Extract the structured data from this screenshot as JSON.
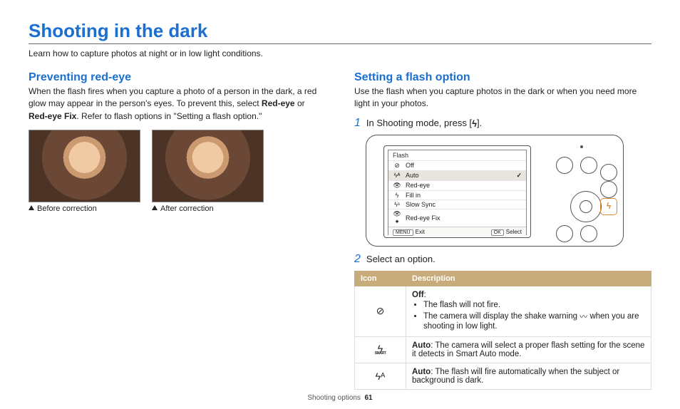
{
  "page_title": "Shooting in the dark",
  "intro": "Learn how to capture photos at night or in low light conditions.",
  "left": {
    "section_title": "Preventing red-eye",
    "text_1": "When the flash fires when you capture a photo of a person in the dark, a red glow may appear in the person's eyes. To prevent this, select ",
    "bold_1": "Red-eye",
    "text_2": " or ",
    "bold_2": "Red-eye Fix",
    "text_3": ". Refer to flash options in \"Setting a flash option.\"",
    "caption_before": "Before correction",
    "caption_after": "After correction"
  },
  "right": {
    "section_title": "Setting a flash option",
    "intro": "Use the flash when you capture photos in the dark or when you need more light in your photos.",
    "step1_pre": "In Shooting mode, press [",
    "step1_post": "].",
    "step2": "Select an option.",
    "menu": {
      "header": "Flash",
      "items": [
        {
          "icon": "⊘",
          "label": "Off"
        },
        {
          "icon": "ϟᴬ",
          "label": "Auto",
          "selected": true
        },
        {
          "icon": "👁",
          "label": "Red-eye"
        },
        {
          "icon": "ϟ",
          "label": "Fill in"
        },
        {
          "icon": "ϟˢ",
          "label": "Slow Sync"
        },
        {
          "icon": "👁✦",
          "label": "Red-eye Fix"
        }
      ],
      "footer_left_btn": "MENU",
      "footer_left": "Exit",
      "footer_right_btn": "OK",
      "footer_right": "Select"
    },
    "table": {
      "col_icon": "Icon",
      "col_desc": "Description",
      "rows": [
        {
          "icon": "⊘",
          "title": "Off",
          "bullets": [
            "The flash will not fire.",
            "The camera will display the shake warning 〰 when you are shooting in low light."
          ]
        },
        {
          "icon": "ϟSMART",
          "title": "Auto",
          "text": ": The camera will select a proper flash setting for the scene it detects in Smart Auto mode."
        },
        {
          "icon": "ϟᴬ",
          "title": "Auto",
          "text": ": The flash will fire automatically when the subject or background is dark."
        }
      ]
    }
  },
  "footer": {
    "section": "Shooting options",
    "page": "61"
  }
}
